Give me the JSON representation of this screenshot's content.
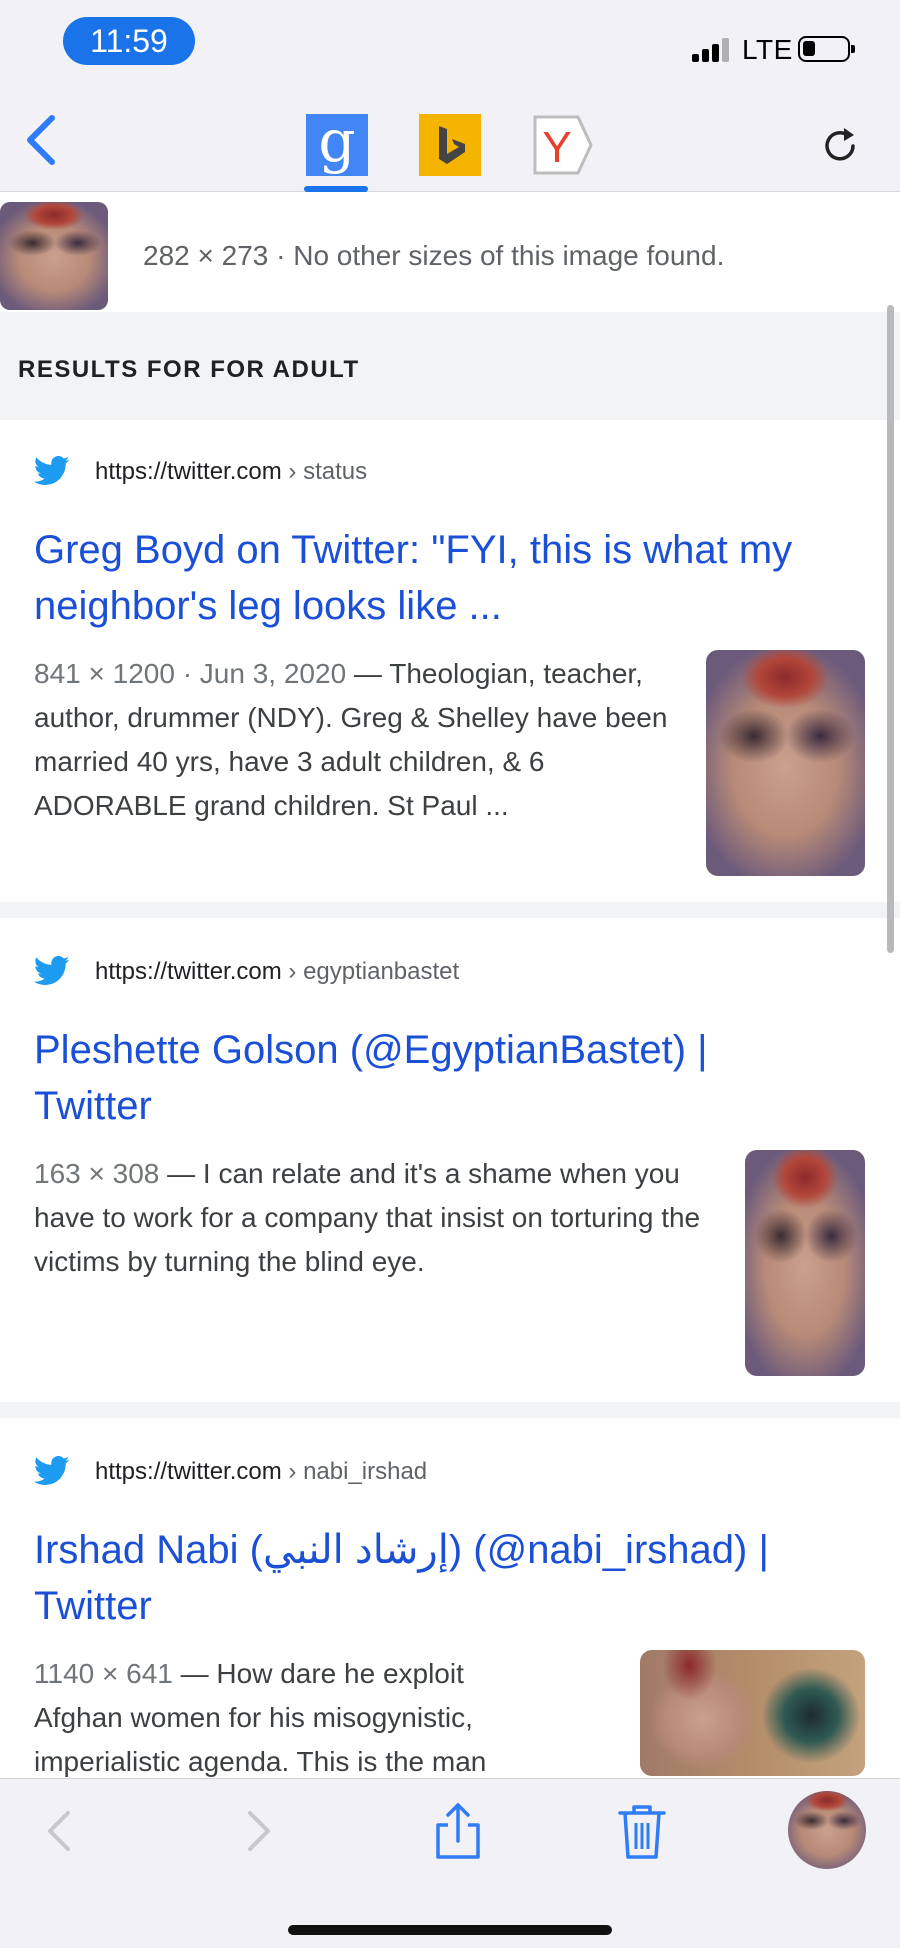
{
  "status_bar": {
    "time": "11:59",
    "carrier": "LTE",
    "battery_level": 0.3
  },
  "toolbar": {
    "engines": [
      {
        "name": "google",
        "label": "g",
        "selected": true,
        "color": "#4285f4"
      },
      {
        "name": "bing",
        "label": "b",
        "selected": false,
        "color": "#f4b400"
      },
      {
        "name": "yandex",
        "label": "Y",
        "selected": false,
        "color": "#e8402e"
      }
    ]
  },
  "image_info": {
    "text": "282 × 273 · No other sizes of this image found."
  },
  "section": {
    "header": "RESULTS FOR FOR ADULT"
  },
  "results": [
    {
      "site": "https://twitter.com",
      "crumb": " › status",
      "title": "Greg Boyd on Twitter: \"FYI, this is what my neighbor's leg looks like ...",
      "meta": "841 × 1200 · Jun 3, 2020",
      "dash": " — ",
      "snippet": "Theologian, teacher, author, drummer (NDY). Greg & Shelley have been married 40 yrs, have 3 adult children, & 6 ADORABLE grand children. St Paul ..."
    },
    {
      "site": "https://twitter.com",
      "crumb": " › egyptianbastet",
      "title": "Pleshette Golson (@EgyptianBastet) | Twitter",
      "meta": "163 × 308",
      "dash": " — ",
      "snippet": "I can relate and it's a shame when you have to work for a company that insist on torturing the victims by turning the blind eye."
    },
    {
      "site": "https://twitter.com",
      "crumb": " › nabi_irshad",
      "title": "Irshad Nabi (إرشاد النبي) (@nabi_irshad) | Twitter",
      "meta": "1140 × 641",
      "dash": " — ",
      "snippet": "How dare he exploit Afghan women for his misogynistic, imperialistic agenda. This is the man"
    }
  ],
  "colors": {
    "link": "#1a4fd6",
    "accent": "#1a73e8",
    "twitter": "#1d9bf0",
    "ios_blue": "#2f7cf6"
  }
}
